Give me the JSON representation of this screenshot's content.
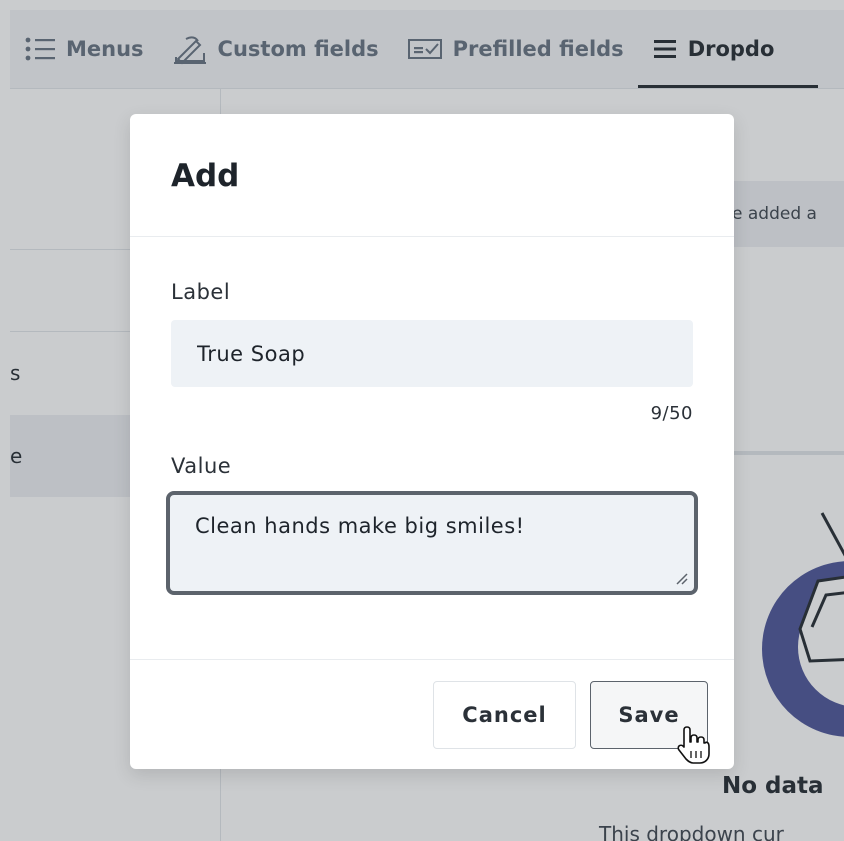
{
  "tabs": [
    {
      "label": "Menus",
      "icon": "list-icon"
    },
    {
      "label": "Custom fields",
      "icon": "signature-icon"
    },
    {
      "label": "Prefilled fields",
      "icon": "prefilled-icon"
    },
    {
      "label": "Dropdo",
      "icon": "menu-lines-icon",
      "active": true
    }
  ],
  "background": {
    "left_items": [
      "s",
      "e"
    ],
    "notice_text": "e added a",
    "empty_title": "No data",
    "empty_subtitle": "This dropdown cur"
  },
  "modal": {
    "title": "Add",
    "label_field": {
      "label": "Label",
      "value": "True Soap",
      "count": "9/50"
    },
    "value_field": {
      "label": "Value",
      "value": "Clean hands make big smiles!"
    },
    "cancel_label": "Cancel",
    "save_label": "Save"
  },
  "colors": {
    "accent_dark": "#2b3138",
    "muted_text": "#6b7785",
    "input_bg": "#eef2f6",
    "illustration_purple": "#525a9c"
  }
}
